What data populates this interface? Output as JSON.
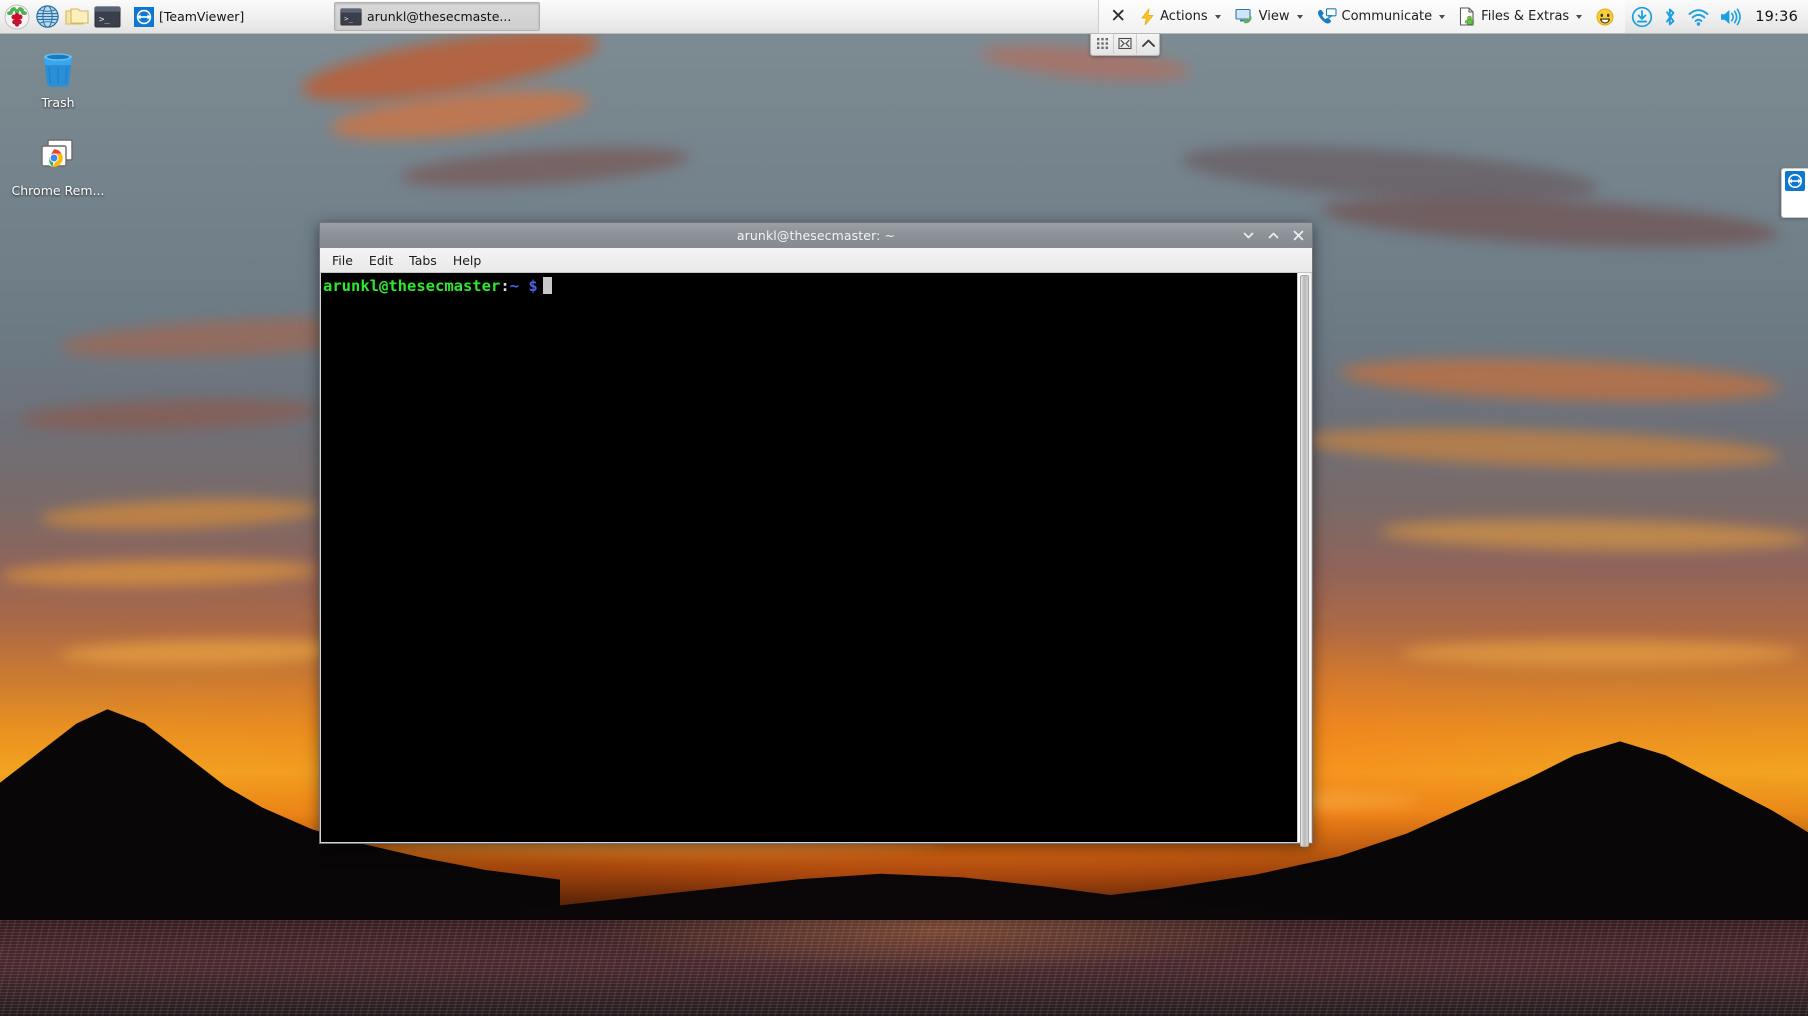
{
  "desktop": {
    "wallpaper_description": "sunset-over-lake-with-mountains",
    "icons": [
      {
        "name": "Trash",
        "icon": "trash-icon"
      },
      {
        "name": "Chrome Rem...",
        "icon": "chrome-remote-desktop-icon"
      }
    ]
  },
  "panel": {
    "launchers": [
      {
        "label": "Raspberry Pi Menu",
        "icon": "raspberry-menu-icon"
      },
      {
        "label": "Web Browser",
        "icon": "globe-browser-icon"
      },
      {
        "label": "File Manager",
        "icon": "file-manager-icon"
      },
      {
        "label": "Terminal",
        "icon": "terminal-icon"
      }
    ],
    "tasks": [
      {
        "label": "[TeamViewer]",
        "icon": "teamviewer-icon",
        "active": false
      },
      {
        "label": "arunkl@thesecmaste...",
        "icon": "terminal-icon",
        "active": true
      }
    ],
    "teamviewer_menu": {
      "close_label": "✕",
      "items": [
        {
          "label": "Actions",
          "icon": "lightning-bolt-icon",
          "has_caret": true
        },
        {
          "label": "View",
          "icon": "monitor-icon",
          "has_caret": true
        },
        {
          "label": "Communicate",
          "icon": "phone-chat-icon",
          "has_caret": true
        },
        {
          "label": "Files & Extras",
          "icon": "file-extras-icon",
          "has_caret": true
        },
        {
          "label": "",
          "icon": "smiley-icon",
          "has_caret": false
        }
      ]
    },
    "tray": [
      {
        "label": "Updates Available",
        "icon": "download-update-icon"
      },
      {
        "label": "Bluetooth",
        "icon": "bluetooth-icon"
      },
      {
        "label": "Wireless Network",
        "icon": "wifi-icon"
      },
      {
        "label": "Volume",
        "icon": "volume-icon"
      }
    ],
    "clock": "19:36"
  },
  "float_toolbar": {
    "buttons": [
      {
        "label": "Grid",
        "icon": "grid-icon"
      },
      {
        "label": "Fullscreen",
        "icon": "fullscreen-icon"
      },
      {
        "label": "Collapse",
        "icon": "chevron-up-icon"
      }
    ]
  },
  "side_tab": {
    "label": "TeamViewer",
    "icon": "teamviewer-icon"
  },
  "terminal_window": {
    "title": "arunkl@thesecmaster: ~",
    "window_buttons": {
      "minimize": "⌄",
      "maximize": "⌃",
      "close": "✕"
    },
    "menus": [
      {
        "label": "File"
      },
      {
        "label": "Edit"
      },
      {
        "label": "Tabs"
      },
      {
        "label": "Help"
      }
    ],
    "prompt": {
      "user_host": "arunkl@thesecmaster",
      "colon": ":",
      "path": "~",
      "symbol": "$"
    },
    "output": "",
    "colors": {
      "background": "#000000",
      "prompt_user": "#2ee82e",
      "prompt_path": "#4d61e8",
      "cursor": "#c8c8c8",
      "titlebar": "#8b9197"
    }
  }
}
